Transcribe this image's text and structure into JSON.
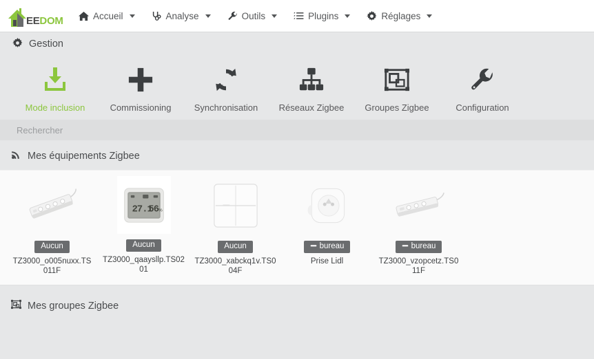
{
  "brand": {
    "ee": "EE",
    "dom": "DOM",
    "icon": "jeedom-house-logo"
  },
  "navbar": {
    "items": [
      {
        "label": "Accueil",
        "icon": "home-icon"
      },
      {
        "label": "Analyse",
        "icon": "stethoscope-icon"
      },
      {
        "label": "Outils",
        "icon": "wrench-icon"
      },
      {
        "label": "Plugins",
        "icon": "list-check-icon"
      },
      {
        "label": "Réglages",
        "icon": "gear-icon"
      }
    ]
  },
  "gestion": {
    "title": "Gestion",
    "icon": "gear-icon",
    "actions": [
      {
        "label": "Mode inclusion",
        "icon": "download-inbox-icon",
        "accent": "#8cc63e"
      },
      {
        "label": "Commissioning",
        "icon": "plus-icon",
        "accent": "#3c3f41"
      },
      {
        "label": "Synchronisation",
        "icon": "sync-arrows-icon",
        "accent": "#3c3f41"
      },
      {
        "label": "Réseaux Zigbee",
        "icon": "sitemap-icon",
        "accent": "#3c3f41"
      },
      {
        "label": "Groupes Zigbee",
        "icon": "object-group-icon",
        "accent": "#3c3f41"
      },
      {
        "label": "Configuration",
        "icon": "wrench-icon",
        "accent": "#3c3f41"
      }
    ]
  },
  "search": {
    "value": "",
    "placeholder": "Rechercher"
  },
  "devices_section": {
    "title": "Mes équipements Zigbee",
    "icon": "broadcast-signal-icon",
    "devices": [
      {
        "name": "TZ3000_o005nuxx.TS011F",
        "badge": "Aucun",
        "badge_icon": "none",
        "art": "power-strip",
        "framed": false
      },
      {
        "name": "TZ3000_qaaysllp.TS0201",
        "badge": "Aucun",
        "badge_icon": "none",
        "art": "temp-humidity-sensor",
        "framed": true,
        "display_temp": "27.1",
        "display_humidity": "56"
      },
      {
        "name": "TZ3000_xabckq1v.TS004F",
        "badge": "Aucun",
        "badge_icon": "none",
        "art": "four-button-switch",
        "framed": false
      },
      {
        "name": "Prise Lidl",
        "badge": "bureau",
        "badge_icon": "room-icon",
        "art": "smart-plug",
        "framed": false
      },
      {
        "name": "TZ3000_vzopcetz.TS011F",
        "badge": "bureau",
        "badge_icon": "room-icon",
        "art": "power-strip",
        "framed": false
      }
    ]
  },
  "groups_section": {
    "title": "Mes groupes Zigbee",
    "icon": "object-group-icon"
  },
  "colors": {
    "brand_green": "#8cc63e",
    "page_bg": "#e6e7e8",
    "panel_bg": "#fafafa",
    "badge_bg": "#6a6c6e",
    "text": "#4a4c4e"
  }
}
